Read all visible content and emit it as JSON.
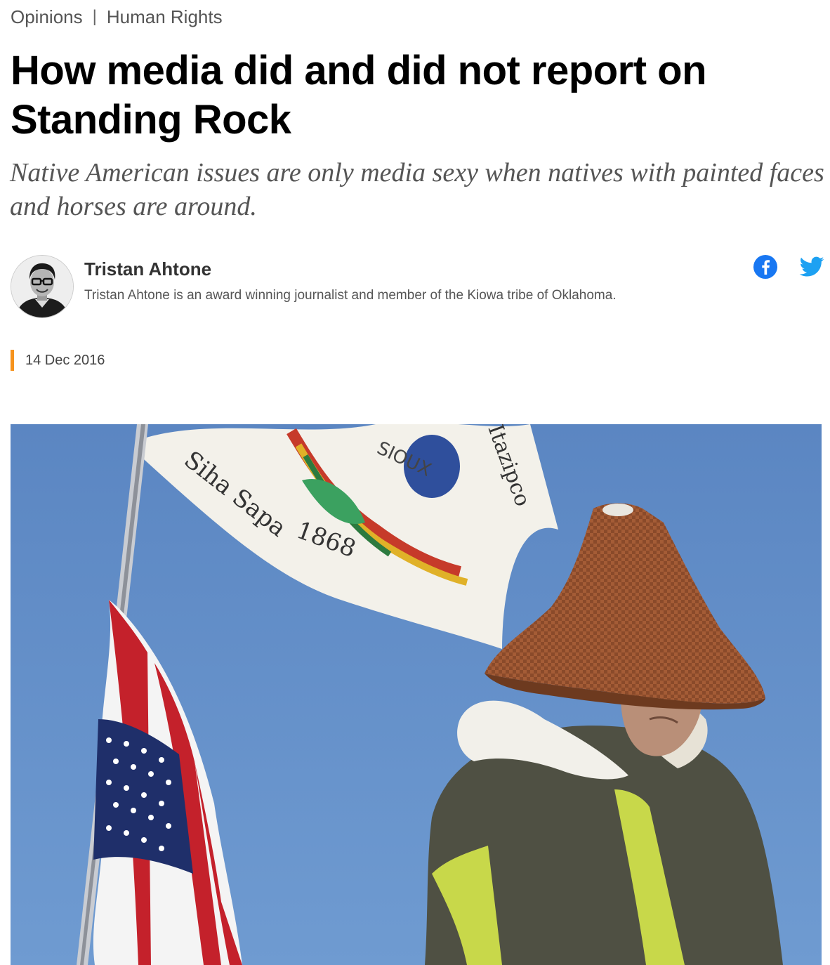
{
  "breadcrumb": {
    "section": "Opinions",
    "separator": "|",
    "topic": "Human Rights"
  },
  "article": {
    "headline": "How media did and did not report on Standing Rock",
    "subhead": "Native American issues are only media sexy when natives with painted faces and horses are around.",
    "date": "14 Dec 2016"
  },
  "author": {
    "name": "Tristan Ahtone",
    "bio": "Tristan Ahtone is an award winning journalist and member of the Kiowa tribe of Oklahoma."
  },
  "social": {
    "icons": [
      "facebook-icon",
      "twitter-icon"
    ],
    "facebook_color": "#1877f2",
    "twitter_color": "#1da1f2"
  },
  "hero_image": {
    "flag_text_top": "Siha Sapa",
    "flag_year": "1868",
    "flag_word": "SIOUX",
    "flag_text_right": "Itazipco"
  },
  "colors": {
    "accent": "#f6931d",
    "sky": "#5f88c4"
  }
}
